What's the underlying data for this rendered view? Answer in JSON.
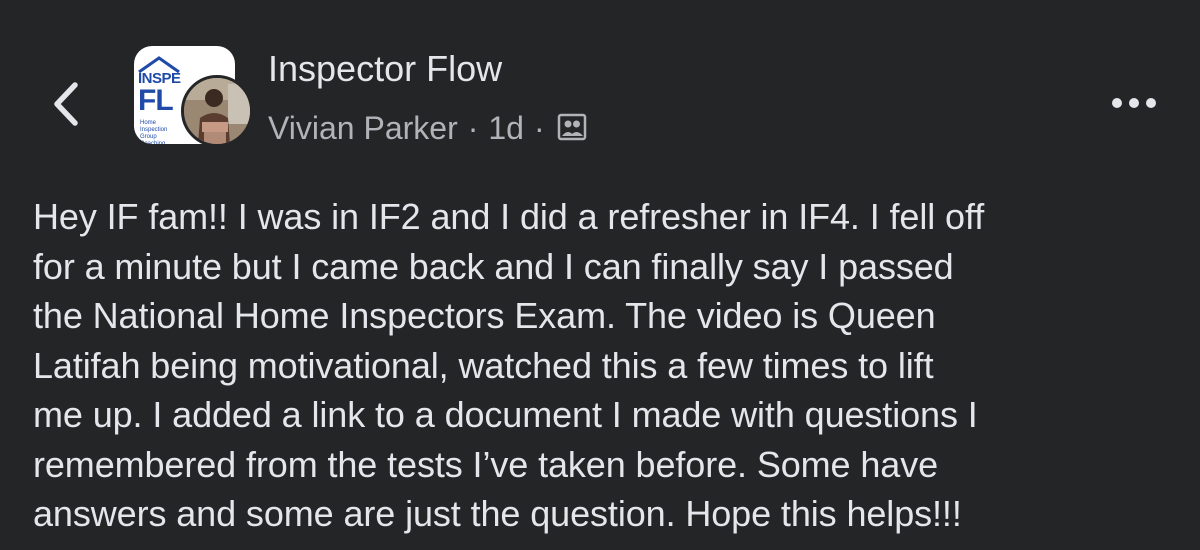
{
  "header": {
    "back_icon": "chevron-left-icon",
    "group_avatar": {
      "logo_line1": "INSPE",
      "logo_line2": "FL",
      "logo_tagline": "Home Inspection Group Coaching"
    },
    "group_name": "Inspector Flow",
    "author_name": "Vivian Parker",
    "separator": "·",
    "timestamp": "1d",
    "audience_icon": "members-icon",
    "more_icon": "more-horizontal-icon"
  },
  "post": {
    "lines": [
      "Hey IF fam!! I was in IF2 and I did a refresher in IF4. I fell off",
      "for a minute but I came back and I can finally say I passed",
      "the National Home Inspectors Exam. The video is Queen",
      "Latifah being motivational, watched this a few times to lift",
      "me up. I added a link to a document I made with questions I",
      "remembered from the tests I’ve taken before. Some have",
      "answers and some are just the question. Hope this helps!!!"
    ]
  },
  "colors": {
    "background": "#242526",
    "primary_text": "#e4e6eb",
    "secondary_text": "#b0b3b8",
    "logo_blue": "#1f4aa8"
  }
}
